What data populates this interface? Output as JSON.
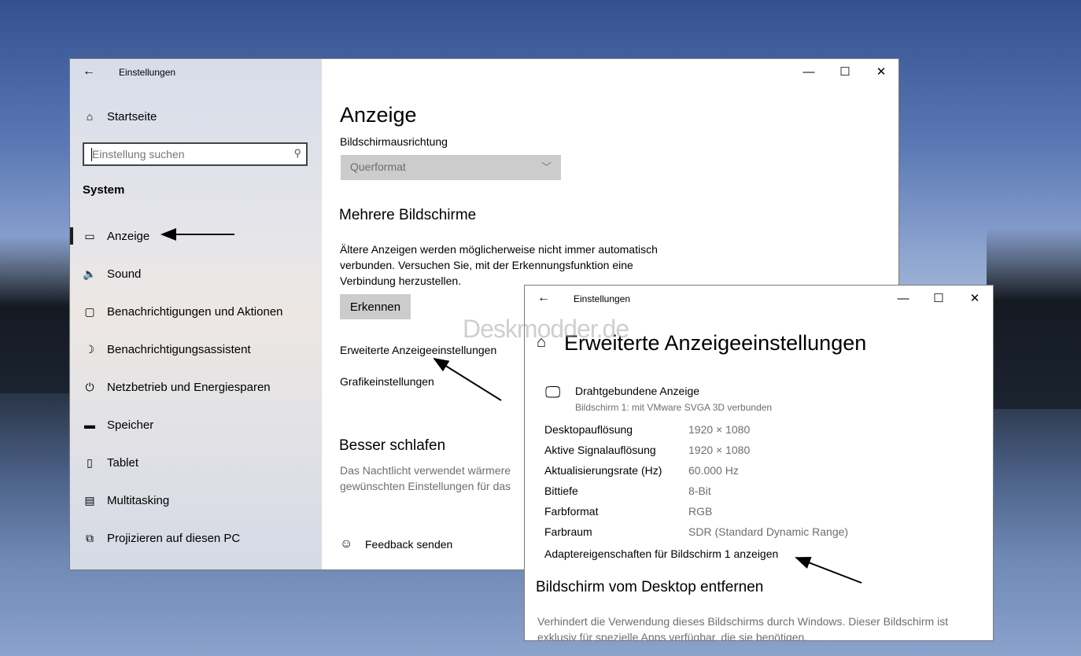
{
  "window1": {
    "title": "Einstellungen",
    "home": "Startseite",
    "search_placeholder": "Einstellung suchen",
    "section": "System",
    "nav_items": [
      {
        "icon": "monitor-icon",
        "label": "Anzeige"
      },
      {
        "icon": "speaker-icon",
        "label": "Sound"
      },
      {
        "icon": "notification-icon",
        "label": "Benachrichtigungen und Aktionen"
      },
      {
        "icon": "moon-icon",
        "label": "Benachrichtigungsassistent"
      },
      {
        "icon": "power-icon",
        "label": "Netzbetrieb und Energiesparen"
      },
      {
        "icon": "storage-icon",
        "label": "Speicher"
      },
      {
        "icon": "tablet-icon",
        "label": "Tablet"
      },
      {
        "icon": "multitasking-icon",
        "label": "Multitasking"
      },
      {
        "icon": "project-icon",
        "label": "Projizieren auf diesen PC"
      }
    ],
    "page_title": "Anzeige",
    "orientation_label": "Bildschirmausrichtung",
    "orientation_value": "Querformat",
    "multi_heading": "Mehrere Bildschirme",
    "multi_text_1": "Ältere Anzeigen werden möglicherweise nicht immer automatisch",
    "multi_text_2": "verbunden. Versuchen Sie, mit der Erkennungsfunktion eine",
    "multi_text_3": "Verbindung herzustellen.",
    "detect_button": "Erkennen",
    "advanced_link": "Erweiterte Anzeigeeinstellungen",
    "graphics_link": "Grafikeinstellungen",
    "sleep_heading": "Besser schlafen",
    "sleep_text_1": "Das Nachtlicht verwendet wärmere",
    "sleep_text_2": "gewünschten Einstellungen für das",
    "feedback": "Feedback senden"
  },
  "window2": {
    "title": "Einstellungen",
    "page_title": "Erweiterte Anzeigeeinstellungen",
    "display_name": "Drahtgebundene Anzeige",
    "display_sub": "Bildschirm 1: mit VMware SVGA 3D verbunden",
    "info": [
      {
        "label": "Desktopauflösung",
        "value": "1920 × 1080"
      },
      {
        "label": "Aktive Signalauflösung",
        "value": "1920 × 1080"
      },
      {
        "label": "Aktualisierungsrate (Hz)",
        "value": "60.000 Hz"
      },
      {
        "label": "Bittiefe",
        "value": "8-Bit"
      },
      {
        "label": "Farbformat",
        "value": "RGB"
      },
      {
        "label": "Farbraum",
        "value": "SDR (Standard Dynamic Range)"
      }
    ],
    "adapter_link": "Adaptereigenschaften für Bildschirm 1 anzeigen",
    "remove_heading": "Bildschirm vom Desktop entfernen",
    "remove_text_1": "Verhindert die Verwendung dieses Bildschirms durch Windows. Dieser Bildschirm ist",
    "remove_text_2": "exklusiv für spezielle Apps verfügbar, die sie benötigen."
  },
  "watermark": "Deskmodder.de"
}
